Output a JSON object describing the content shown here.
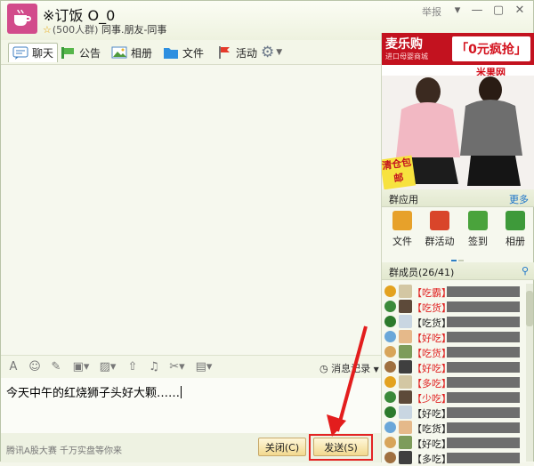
{
  "window": {
    "title": "※订饭 O_0",
    "member_count": "(500人群)",
    "tags": "同事.朋友-同事",
    "report_label": "举报",
    "controls": [
      "▾",
      "—",
      "▢",
      "✕"
    ]
  },
  "toolbar": {
    "items": [
      {
        "label": "聊天",
        "icon": "chat-icon"
      },
      {
        "label": "公告",
        "icon": "announcement-icon"
      },
      {
        "label": "相册",
        "icon": "photo-album-icon"
      },
      {
        "label": "文件",
        "icon": "folder-icon"
      },
      {
        "label": "活动",
        "icon": "flag-icon"
      }
    ],
    "settings_icon": "gear-icon"
  },
  "input_toolbar": {
    "icons": [
      "font-icon",
      "emoji-icon",
      "magic-icon",
      "screen-capture-icon",
      "image-icon",
      "upload-icon",
      "music-icon",
      "scissors-icon",
      "more-icon"
    ],
    "history_label": "消息记录"
  },
  "input": {
    "text": "今天中午的红烧狮子头好大颗……"
  },
  "bottom": {
    "ad_text": "腾讯A股大赛 千万实盘等你来",
    "close_label": "关闭(C)",
    "send_label": "发送(S)"
  },
  "ad": {
    "brand": "麦乐购",
    "slogan": "进口母婴商城",
    "headline": "「0元疯抢」",
    "site": "米果网",
    "tag": "清仓包邮"
  },
  "apps": {
    "title": "群应用",
    "more": "更多",
    "items": [
      {
        "label": "文件",
        "icon": "file-app-icon",
        "color": "#e7a12a"
      },
      {
        "label": "群活动",
        "icon": "group-activity-icon",
        "color": "#d9452a"
      },
      {
        "label": "签到",
        "icon": "checkin-icon",
        "color": "#4aa33c"
      },
      {
        "label": "相册",
        "icon": "album-app-icon",
        "color": "#3e9a3a"
      }
    ]
  },
  "members": {
    "title": "群成员(26/41)",
    "list": [
      {
        "tag": "【吃霸】",
        "color": "#e02020"
      },
      {
        "tag": "【吃货】",
        "color": "#e02020"
      },
      {
        "tag": "【吃货】",
        "color": "#222222"
      },
      {
        "tag": "【好吃】",
        "color": "#e02020"
      },
      {
        "tag": "【吃货】",
        "color": "#e02020"
      },
      {
        "tag": "【好吃】",
        "color": "#e02020"
      },
      {
        "tag": "【多吃】",
        "color": "#e02020"
      },
      {
        "tag": "【少吃】",
        "color": "#e02020"
      },
      {
        "tag": "【好吃】",
        "color": "#222222"
      },
      {
        "tag": "【吃货】",
        "color": "#222222"
      },
      {
        "tag": "【好吃】",
        "color": "#222222"
      },
      {
        "tag": "【多吃】",
        "color": "#222222"
      }
    ]
  },
  "colors": {
    "accent_red": "#e32424",
    "link_blue": "#1a73c9",
    "brand_pink": "#d24b8b"
  }
}
